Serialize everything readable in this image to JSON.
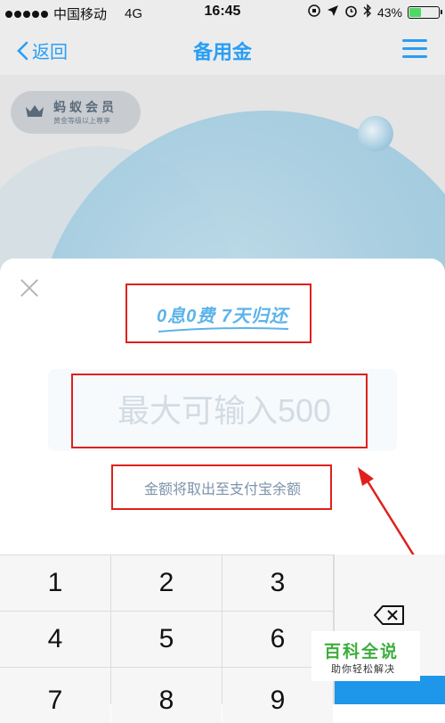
{
  "status_bar": {
    "carrier": "中国移动",
    "network": "4G",
    "time": "16:45",
    "battery": "43%",
    "battery_level": 0.43
  },
  "nav": {
    "back_label": "返回",
    "title": "备用金"
  },
  "background": {
    "member_title": "蚂蚁会员",
    "member_subtitle": "黄金等级以上尊享"
  },
  "sheet": {
    "slogan": "0息0费 7天归还",
    "amount_placeholder": "最大可输入500",
    "hint": "金额将取出至支付宝余额"
  },
  "keypad": {
    "keys": [
      "1",
      "2",
      "3",
      "4",
      "5",
      "6",
      "7",
      "8",
      "9"
    ]
  },
  "watermark": {
    "title": "百科全说",
    "subtitle": "助你轻松解决"
  },
  "colors": {
    "accent": "#2a9ef5",
    "annotation_red": "#e0201c",
    "watermark_green": "#3cae3c"
  }
}
